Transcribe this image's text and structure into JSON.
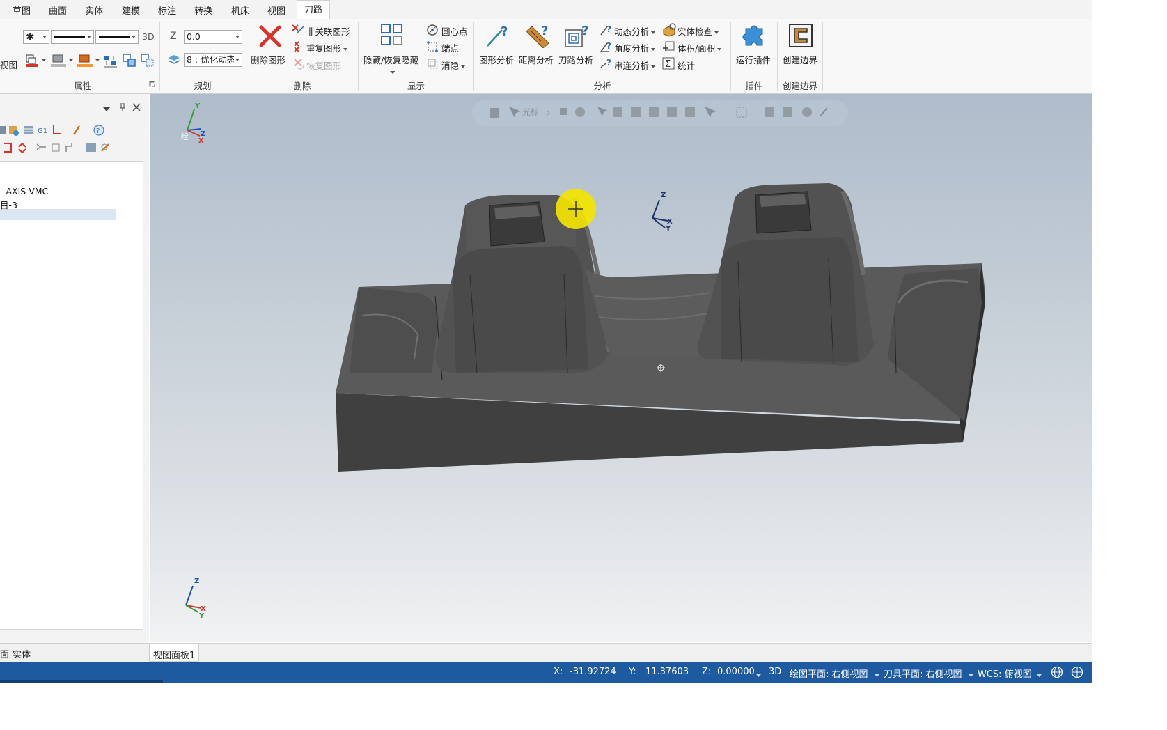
{
  "menu": {
    "items": [
      "草图",
      "曲面",
      "实体",
      "建模",
      "标注",
      "转换",
      "机床",
      "视图",
      "刀路"
    ],
    "active_index": 8
  },
  "ribbon": {
    "left_cut_label": "视图",
    "attributes": {
      "label_3d": "3D",
      "group_label": "属性"
    },
    "plan": {
      "z_label": "Z",
      "z_value": "0.0",
      "level_value": "8 : 优化动态",
      "group_label": "规划"
    },
    "delete": {
      "delete_entity": "删除图形",
      "unrelated": "非关联图形",
      "duplicate": "重复图形",
      "restore": "恢复图形",
      "group_label": "删除"
    },
    "display": {
      "hide_restore": "隐藏/恢复隐藏",
      "center_point": "圆心点",
      "endpoint": "端点",
      "hide": "消隐",
      "group_label": "显示"
    },
    "analysis": {
      "entity_analysis": "图形分析",
      "distance_analysis": "距离分析",
      "toolpath_analysis": "刀路分析",
      "dynamic_analysis": "动态分析",
      "angle_analysis": "角度分析",
      "chain_analysis": "串连分析",
      "solid_check": "实体检查",
      "volume_area": "体积/面积",
      "statistics": "统计",
      "group_label": "分析"
    },
    "addins": {
      "run_addin": "运行插件",
      "group_label": "插件"
    },
    "create_boundary": {
      "button": "创建边界",
      "group_label": "创建边界"
    }
  },
  "tree": {
    "items": [
      "- AXIS VMC",
      "目-3",
      ""
    ]
  },
  "viewport": {
    "toolbar_label": "光标",
    "triad_top": {
      "x": "X",
      "y": "Y",
      "z": "Z",
      "tag": "绘"
    },
    "triad_mid": {
      "x": "X",
      "y": "Y",
      "z": "Z"
    },
    "triad_bottom": {
      "x": "X",
      "y": "Y",
      "z": "Z"
    }
  },
  "bottom_tabs": {
    "left_tab_a": "面",
    "left_tab_b": "实体",
    "view_sheet": "视图面板1"
  },
  "status": {
    "x_label": "X:",
    "x_value": "-31.92724",
    "y_label": "Y:",
    "y_value": "11.37603",
    "z_label": "Z:",
    "z_value": "0.00000",
    "mode": "3D",
    "cplane": "绘图平面: 右侧视图",
    "tplane": "刀具平面: 右侧视图",
    "wcs": "WCS: 俯视图"
  },
  "colors": {
    "status_bar": "#1e5aa0",
    "delete_red": "#d8332a",
    "part_gray": "#4a4a4a",
    "cursor_highlight": "#f2e400"
  }
}
